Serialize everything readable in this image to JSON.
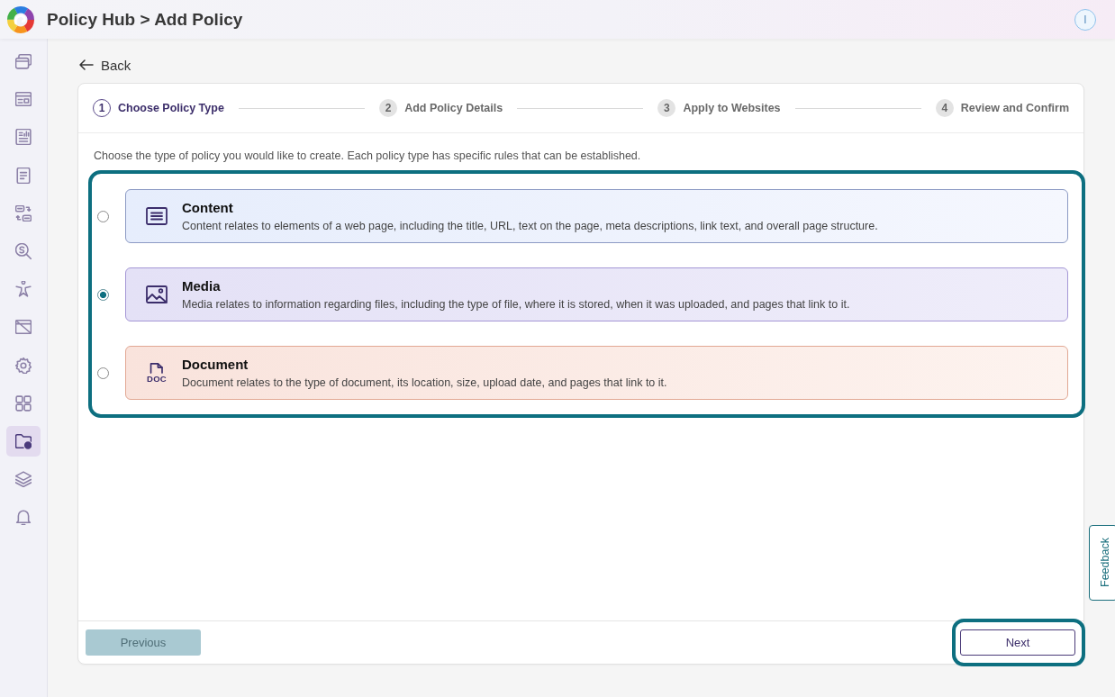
{
  "header": {
    "title": "Policy Hub > Add Policy",
    "user_initial": "I"
  },
  "sidebar": {
    "items": [
      {
        "selected": false
      },
      {
        "selected": false
      },
      {
        "selected": false
      },
      {
        "selected": false
      },
      {
        "selected": false
      },
      {
        "selected": false
      },
      {
        "selected": false
      },
      {
        "selected": false
      },
      {
        "selected": false
      },
      {
        "selected": false
      },
      {
        "selected": true
      },
      {
        "selected": false
      },
      {
        "selected": false
      }
    ]
  },
  "back_link": "Back",
  "stepper": {
    "steps": [
      {
        "number": "1",
        "label": "Choose Policy Type",
        "current": true
      },
      {
        "number": "2",
        "label": "Add Policy Details",
        "current": false
      },
      {
        "number": "3",
        "label": "Apply to Websites",
        "current": false
      },
      {
        "number": "4",
        "label": "Review and Confirm",
        "current": false
      }
    ]
  },
  "instructions": "Choose the type of policy you would like to create. Each policy type has specific rules that can be established.",
  "policy_types": {
    "highlighted": true,
    "options": [
      {
        "kind": "content",
        "title": "Content",
        "description": "Content relates to elements of a web page, including the title, URL, text on the page, meta descriptions, link text, and overall page structure.",
        "selected": false
      },
      {
        "kind": "media",
        "title": "Media",
        "description": "Media relates to information regarding files, including the type of file, where it is stored, when it was uploaded, and pages that link to it.",
        "selected": true
      },
      {
        "kind": "document",
        "icon_label": "DOC",
        "title": "Document",
        "description": "Document relates to the type of document, its location, size, upload date, and pages that link to it.",
        "selected": false
      }
    ]
  },
  "footer": {
    "previous": {
      "label": "Previous",
      "disabled": true
    },
    "next": {
      "label": "Next",
      "disabled": false,
      "highlighted": true
    }
  },
  "feedback": "Feedback"
}
